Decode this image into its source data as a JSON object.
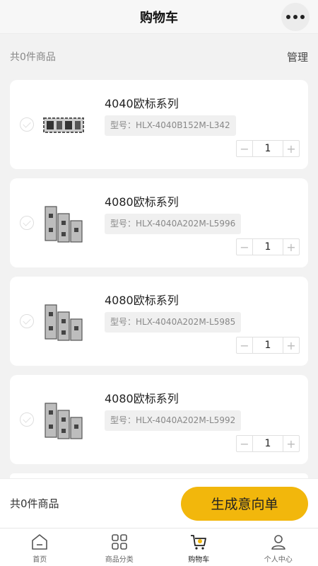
{
  "header": {
    "title": "购物车",
    "more_icon": "more-dots-icon"
  },
  "summary": {
    "count_text": "共0件商品",
    "manage_label": "管理"
  },
  "items": [
    {
      "name": "4040欧标系列",
      "model": "型号：HLX-4040B152M-L342",
      "qty": "1",
      "minus": "−",
      "plus": "+"
    },
    {
      "name": "4080欧标系列",
      "model": "型号：HLX-4040A202M-L5996",
      "qty": "1",
      "minus": "−",
      "plus": "+"
    },
    {
      "name": "4080欧标系列",
      "model": "型号：HLX-4040A202M-L5985",
      "qty": "1",
      "minus": "−",
      "plus": "+"
    },
    {
      "name": "4080欧标系列",
      "model": "型号：HLX-4040A202M-L5992",
      "qty": "1",
      "minus": "−",
      "plus": "+"
    }
  ],
  "footer": {
    "count_text": "共0件商品",
    "generate_label": "生成意向单"
  },
  "tabbar": [
    {
      "label": "首页",
      "icon": "home-icon"
    },
    {
      "label": "商品分类",
      "icon": "category-grid-icon"
    },
    {
      "label": "购物车",
      "icon": "cart-icon",
      "active": true
    },
    {
      "label": "个人中心",
      "icon": "user-icon"
    }
  ],
  "colors": {
    "accent": "#f2b70c",
    "background": "#f2f2f2"
  }
}
